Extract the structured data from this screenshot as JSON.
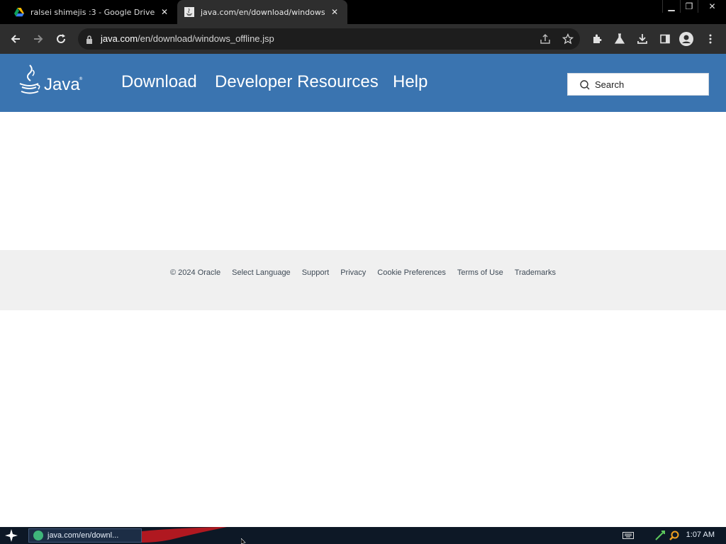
{
  "browser": {
    "tabs": [
      {
        "title": "ralsei shimejis :3 - Google Drive",
        "icon": "google-drive-icon",
        "active": false
      },
      {
        "title": "java.com/en/download/windows_of",
        "icon": "java-icon",
        "active": true
      }
    ],
    "url": {
      "host": "java.com",
      "path": "/en/download/windows_offline.jsp"
    }
  },
  "site": {
    "logo_text": "Java",
    "logo_tm": "®",
    "nav": [
      "Download",
      "Developer Resources",
      "Help"
    ],
    "search_placeholder": "Search",
    "header_color": "#3a74b0"
  },
  "footer": {
    "links": [
      "© 2024 Oracle",
      "Select Language",
      "Support",
      "Privacy",
      "Cookie Preferences",
      "Terms of Use",
      "Trademarks"
    ]
  },
  "taskbar": {
    "task_label": "java.com/en/downl...",
    "clock": "1:07 AM"
  }
}
